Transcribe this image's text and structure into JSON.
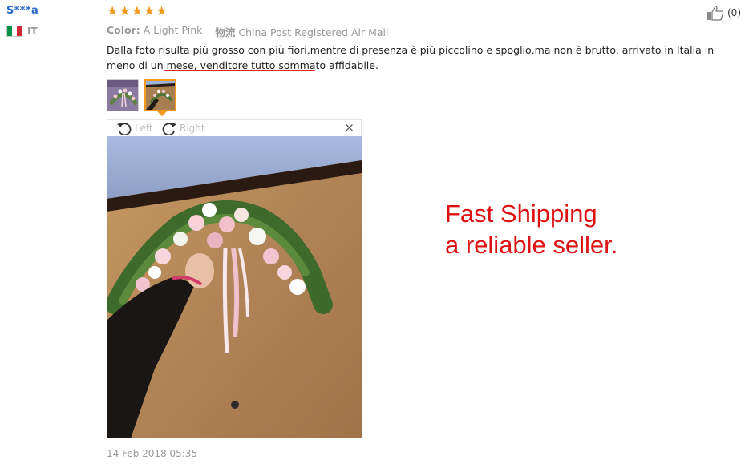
{
  "reviewer": {
    "name": "S***a",
    "country": "IT",
    "flag_colors": [
      "#009246",
      "#ffffff",
      "#ce2b37"
    ]
  },
  "rating": {
    "stars": 5,
    "star_color": "#f39a1d"
  },
  "helpful": {
    "count": "(0)"
  },
  "meta": {
    "color_label": "Color:",
    "color_value": "A Light Pink",
    "shipping_label": "物流",
    "shipping_value": "China Post Registered Air Mail"
  },
  "review": {
    "text": "Dalla foto risulta più grosso con più fiori,mentre di presenza è più piccolino e spoglio,ma non è brutto. arrivato in Italia in meno di un mese, venditore tutto sommato affidabile."
  },
  "viewer": {
    "rotate_left_label": "Left",
    "rotate_right_label": "Right",
    "close_symbol": "×"
  },
  "posted_date": "14 Feb 2018 05:35",
  "annotation": {
    "line1": "Fast Shipping",
    "line2": "a reliable seller.",
    "color": "#d11111"
  }
}
